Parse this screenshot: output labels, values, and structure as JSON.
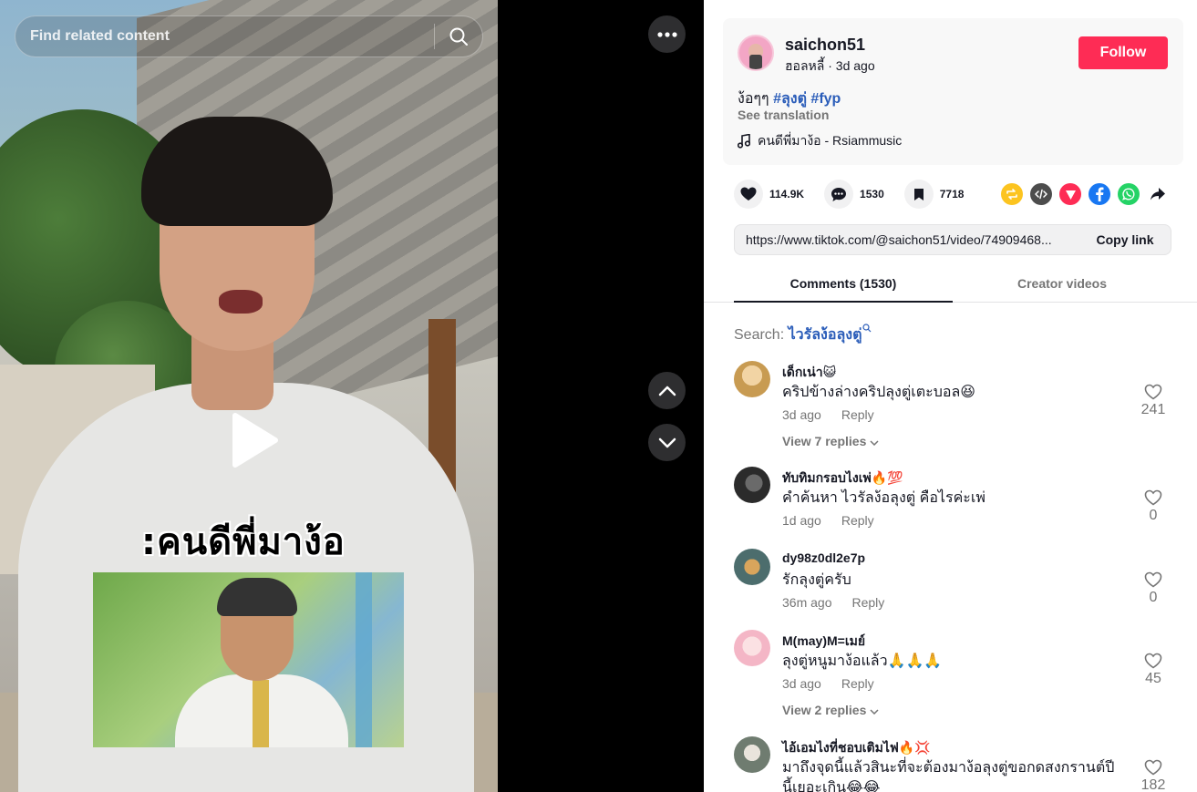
{
  "video": {
    "search_placeholder": "Find related content",
    "caption": ":คนดีพี่มาง้อ"
  },
  "post": {
    "username": "saichon51",
    "meta": "ฮอลหลี้ · 3d ago",
    "follow_label": "Follow",
    "desc_text": "ง้อๆๆ ",
    "hashtags": [
      "#ลุงตู่",
      "#fyp"
    ],
    "see_translation": "See translation",
    "music": "คนดีพี่มาง้อ - Rsiammusic"
  },
  "stats": {
    "likes": "114.9K",
    "comments": "1530",
    "saves": "7718"
  },
  "share_icons": [
    "repost-icon",
    "embed-icon",
    "send-icon",
    "facebook-icon",
    "whatsapp-icon",
    "share-arrow-icon"
  ],
  "link": {
    "url": "https://www.tiktok.com/@saichon51/video/74909468...",
    "copy_label": "Copy link"
  },
  "tabs": [
    "Comments (1530)",
    "Creator videos"
  ],
  "comment_search": {
    "label": "Search: ",
    "keyword": "ไวรัลง้อลุงตู่"
  },
  "comments": [
    {
      "user": "เด็กเน่า😺",
      "text": "คริปข้างล่างคริปลุงตู่เตะบอล😆",
      "time": "3d ago",
      "reply": "Reply",
      "likes": "241",
      "view_replies": "View 7 replies"
    },
    {
      "user": "ทับทิมกรอบไงเพ่🔥💯",
      "text": "คำค้นหา ไวรัลง้อลุงตู่ คือไรค่ะเพ่",
      "time": "1d ago",
      "reply": "Reply",
      "likes": "0"
    },
    {
      "user": "dy98z0dl2e7p",
      "text": "รักลุงตู่ครับ",
      "time": "36m ago",
      "reply": "Reply",
      "likes": "0"
    },
    {
      "user": "M(may)M=เมย์",
      "text": "ลุงตู่หนูมาง้อแล้ว🙏🙏🙏",
      "time": "3d ago",
      "reply": "Reply",
      "likes": "45",
      "view_replies": "View 2 replies"
    },
    {
      "user": "ไอ้เอมไงที่ชอบเติมไฟ🔥💢",
      "text": "มาถึงจุดนี้แล้วสินะที่จะต้องมาง้อลุงตู่ขอกดสงกรานต์ปีนี้เยอะเกิน😂😂",
      "likes": "182"
    }
  ],
  "colors": {
    "accent": "#fe2c55",
    "hashtag": "#2b5db9",
    "muted": "#757575"
  }
}
